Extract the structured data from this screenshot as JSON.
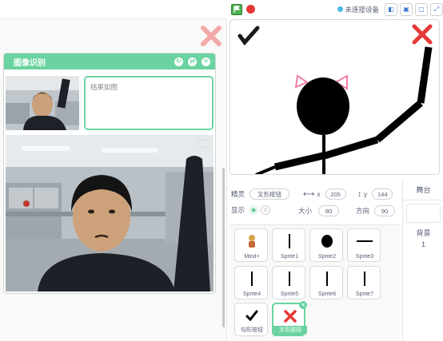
{
  "workspace": {
    "panel_title": "图像识别",
    "result_text": "结果如图"
  },
  "stage_header": {
    "device_status": "未连接设备"
  },
  "sprite_info": {
    "sprite_label": "精灵",
    "sprite_name": "叉形按钮",
    "x_label": "x",
    "x_value": "205",
    "y_label": "y",
    "y_value": "144",
    "show_label": "显示",
    "size_label": "大小",
    "size_value": "80",
    "direction_label": "方向",
    "direction_value": "90"
  },
  "sprites": [
    {
      "name": "Mind+",
      "icon": "mindplus-icon"
    },
    {
      "name": "Sprite1",
      "icon": "line-icon"
    },
    {
      "name": "Sprite2",
      "icon": "head-icon"
    },
    {
      "name": "Sprite3",
      "icon": "hline-icon"
    },
    {
      "name": "Sprite4",
      "icon": "line-icon"
    },
    {
      "name": "Sprite5",
      "icon": "line-icon"
    },
    {
      "name": "Sprite6",
      "icon": "line-icon"
    },
    {
      "name": "Sprite7",
      "icon": "line-icon"
    },
    {
      "name": "勾形按钮",
      "icon": "check-icon"
    },
    {
      "name": "叉形按钮",
      "icon": "cross-icon",
      "selected": true
    }
  ],
  "stage_pane": {
    "tab_label": "舞台",
    "backdrop_label": "背景",
    "backdrop_count": "1"
  },
  "colors": {
    "accent": "#6ad3a1",
    "cross": "#e53935",
    "text": "#575e75"
  }
}
